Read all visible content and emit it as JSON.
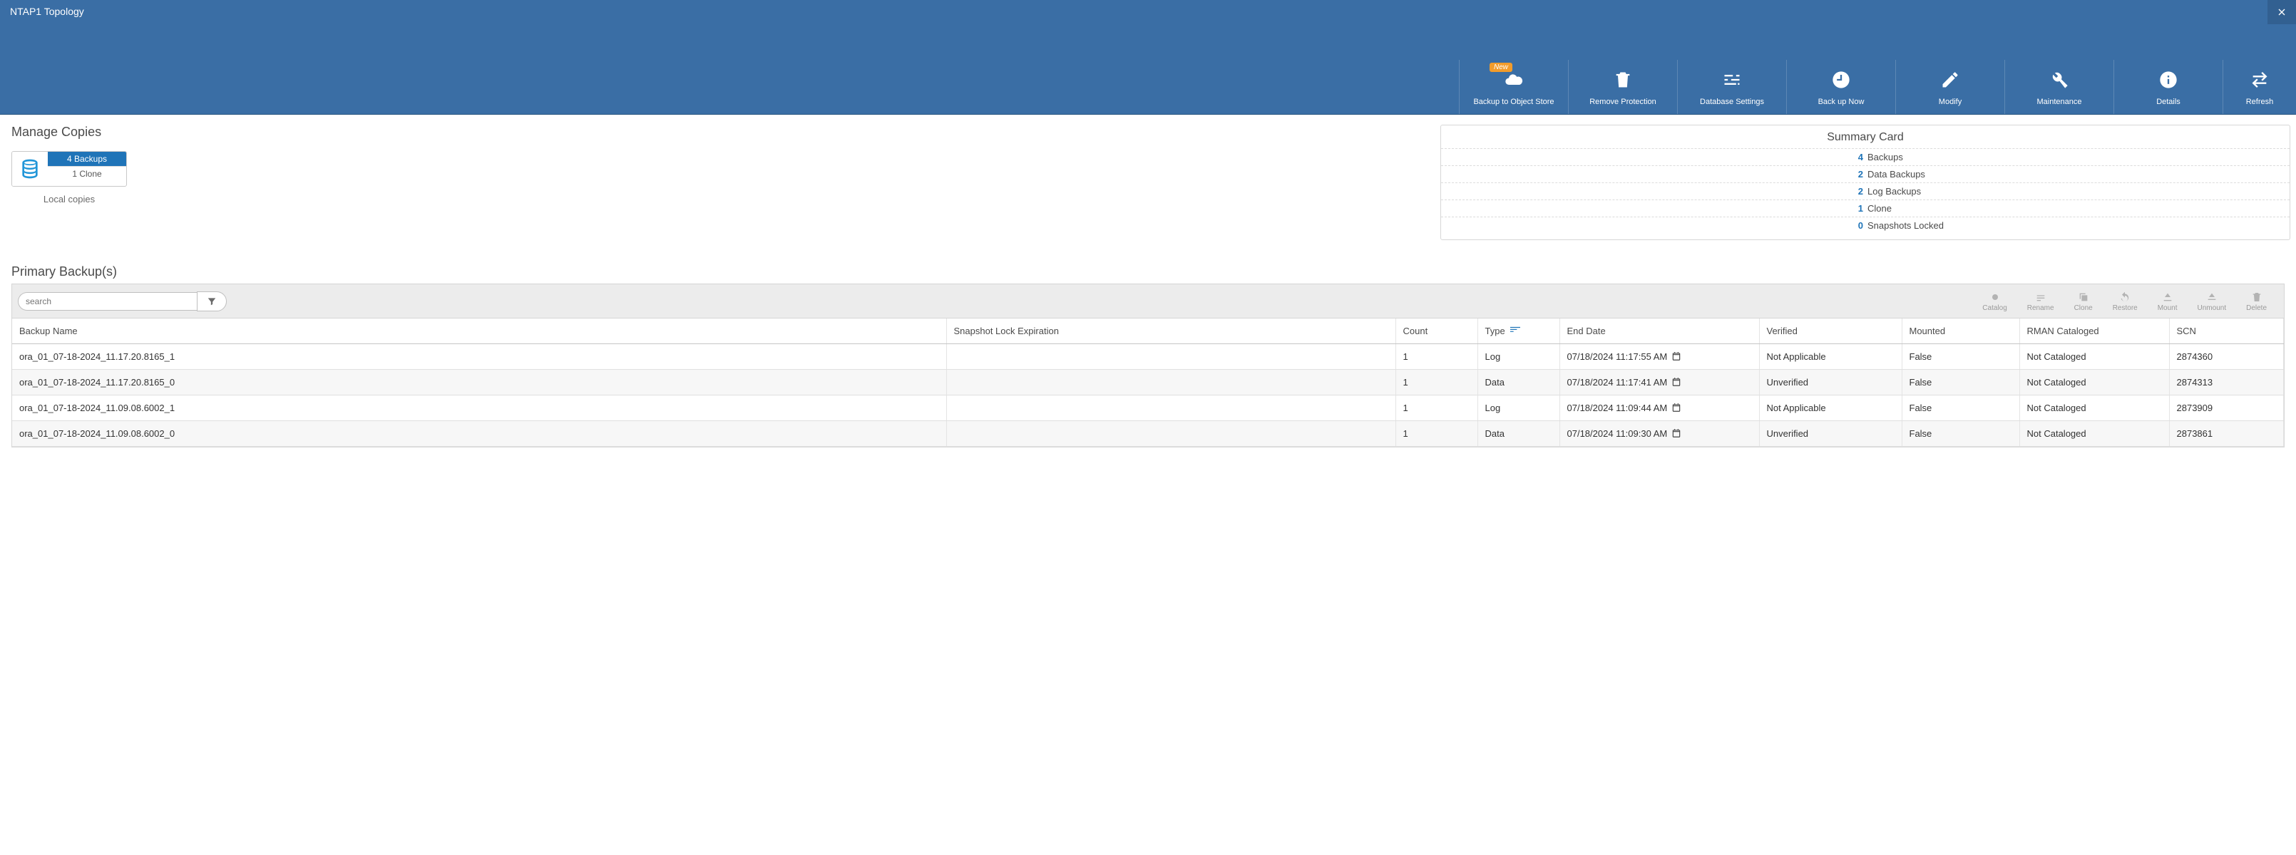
{
  "header": {
    "title": "NTAP1 Topology",
    "toolbar": [
      {
        "id": "backup-obj-store",
        "label": "Backup to Object Store",
        "icon": "cloud",
        "new_badge": "New"
      },
      {
        "id": "remove-protection",
        "label": "Remove Protection",
        "icon": "trash"
      },
      {
        "id": "database-settings",
        "label": "Database Settings",
        "icon": "sliders"
      },
      {
        "id": "backup-now",
        "label": "Back up Now",
        "icon": "clock"
      },
      {
        "id": "modify",
        "label": "Modify",
        "icon": "pencil"
      },
      {
        "id": "maintenance",
        "label": "Maintenance",
        "icon": "wrench"
      },
      {
        "id": "details",
        "label": "Details",
        "icon": "info"
      },
      {
        "id": "refresh",
        "label": "Refresh",
        "icon": "swap"
      }
    ]
  },
  "manage_copies": {
    "title": "Manage Copies",
    "local_label": "Local copies",
    "backups_chip": "4 Backups",
    "clone_chip": "1 Clone"
  },
  "summary": {
    "title": "Summary Card",
    "rows": [
      {
        "n": "4",
        "t": "Backups"
      },
      {
        "n": "2",
        "t": "Data Backups"
      },
      {
        "n": "2",
        "t": "Log Backups"
      },
      {
        "n": "1",
        "t": "Clone"
      },
      {
        "n": "0",
        "t": "Snapshots Locked"
      }
    ]
  },
  "primary": {
    "title": "Primary Backup(s)",
    "search_placeholder": "search",
    "row_actions": [
      {
        "id": "catalog",
        "label": "Catalog",
        "icon": "tag"
      },
      {
        "id": "rename",
        "label": "Rename",
        "icon": "rename"
      },
      {
        "id": "clone",
        "label": "Clone",
        "icon": "copy"
      },
      {
        "id": "restore",
        "label": "Restore",
        "icon": "undo"
      },
      {
        "id": "mount",
        "label": "Mount",
        "icon": "mount"
      },
      {
        "id": "unmount",
        "label": "Unmount",
        "icon": "eject"
      },
      {
        "id": "delete",
        "label": "Delete",
        "icon": "trash"
      }
    ],
    "columns": {
      "backup_name": "Backup Name",
      "lock_exp": "Snapshot Lock Expiration",
      "count": "Count",
      "type": "Type",
      "end_date": "End Date",
      "verified": "Verified",
      "mounted": "Mounted",
      "rman": "RMAN Cataloged",
      "scn": "SCN"
    },
    "rows": [
      {
        "name": "ora_01_07-18-2024_11.17.20.8165_1",
        "lock": "",
        "count": "1",
        "type": "Log",
        "end": "07/18/2024 11:17:55 AM",
        "verified": "Not Applicable",
        "mounted": "False",
        "rman": "Not Cataloged",
        "scn": "2874360"
      },
      {
        "name": "ora_01_07-18-2024_11.17.20.8165_0",
        "lock": "",
        "count": "1",
        "type": "Data",
        "end": "07/18/2024 11:17:41 AM",
        "verified": "Unverified",
        "mounted": "False",
        "rman": "Not Cataloged",
        "scn": "2874313"
      },
      {
        "name": "ora_01_07-18-2024_11.09.08.6002_1",
        "lock": "",
        "count": "1",
        "type": "Log",
        "end": "07/18/2024 11:09:44 AM",
        "verified": "Not Applicable",
        "mounted": "False",
        "rman": "Not Cataloged",
        "scn": "2873909"
      },
      {
        "name": "ora_01_07-18-2024_11.09.08.6002_0",
        "lock": "",
        "count": "1",
        "type": "Data",
        "end": "07/18/2024 11:09:30 AM",
        "verified": "Unverified",
        "mounted": "False",
        "rman": "Not Cataloged",
        "scn": "2873861"
      }
    ]
  }
}
